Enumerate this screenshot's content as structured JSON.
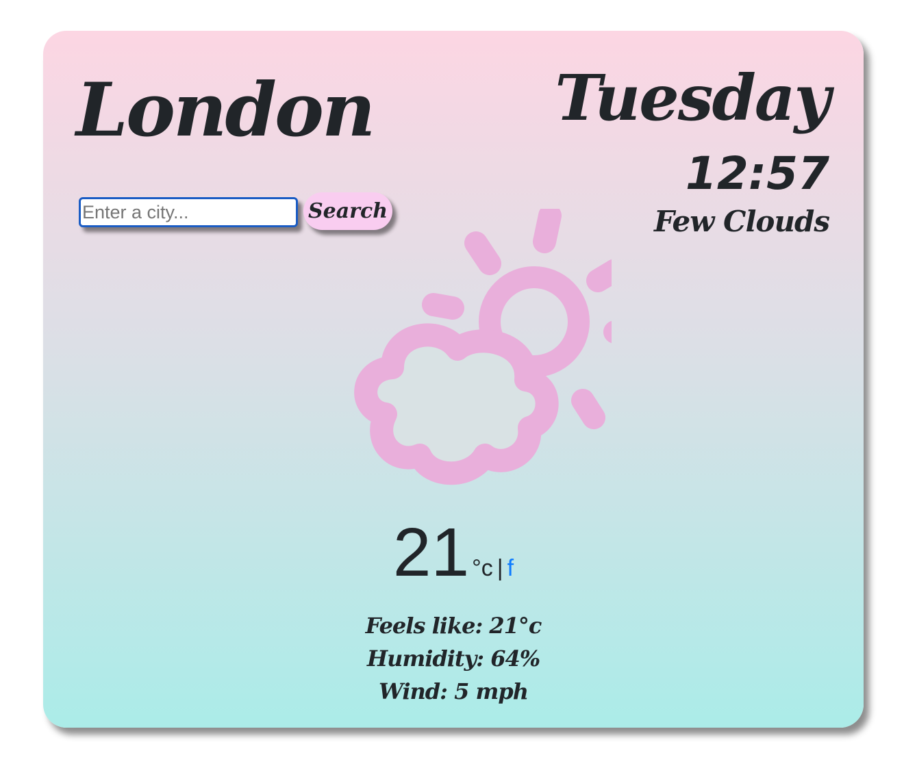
{
  "location": {
    "city": "London"
  },
  "datetime": {
    "day": "Tuesday",
    "time": "12:57"
  },
  "conditions": {
    "description": "Few Clouds",
    "icon": "few-clouds-icon"
  },
  "search": {
    "placeholder": "Enter a city...",
    "value": "",
    "button_label": "Search"
  },
  "temperature": {
    "value": "21",
    "unit_celsius": "°c",
    "separator": "|",
    "unit_fahrenheit": "f"
  },
  "details": {
    "feels_like_label": "Feels like:",
    "feels_like_value": "21°c",
    "humidity_label": "Humidity:",
    "humidity_value": "64%",
    "wind_label": "Wind:",
    "wind_value": "5 mph"
  },
  "colors": {
    "gradient_top": "#fcd6e3",
    "gradient_bottom": "#abece8",
    "icon": "#e9afdb",
    "button": "#f9cdf0",
    "link": "#0d7bff",
    "text": "#212529"
  }
}
